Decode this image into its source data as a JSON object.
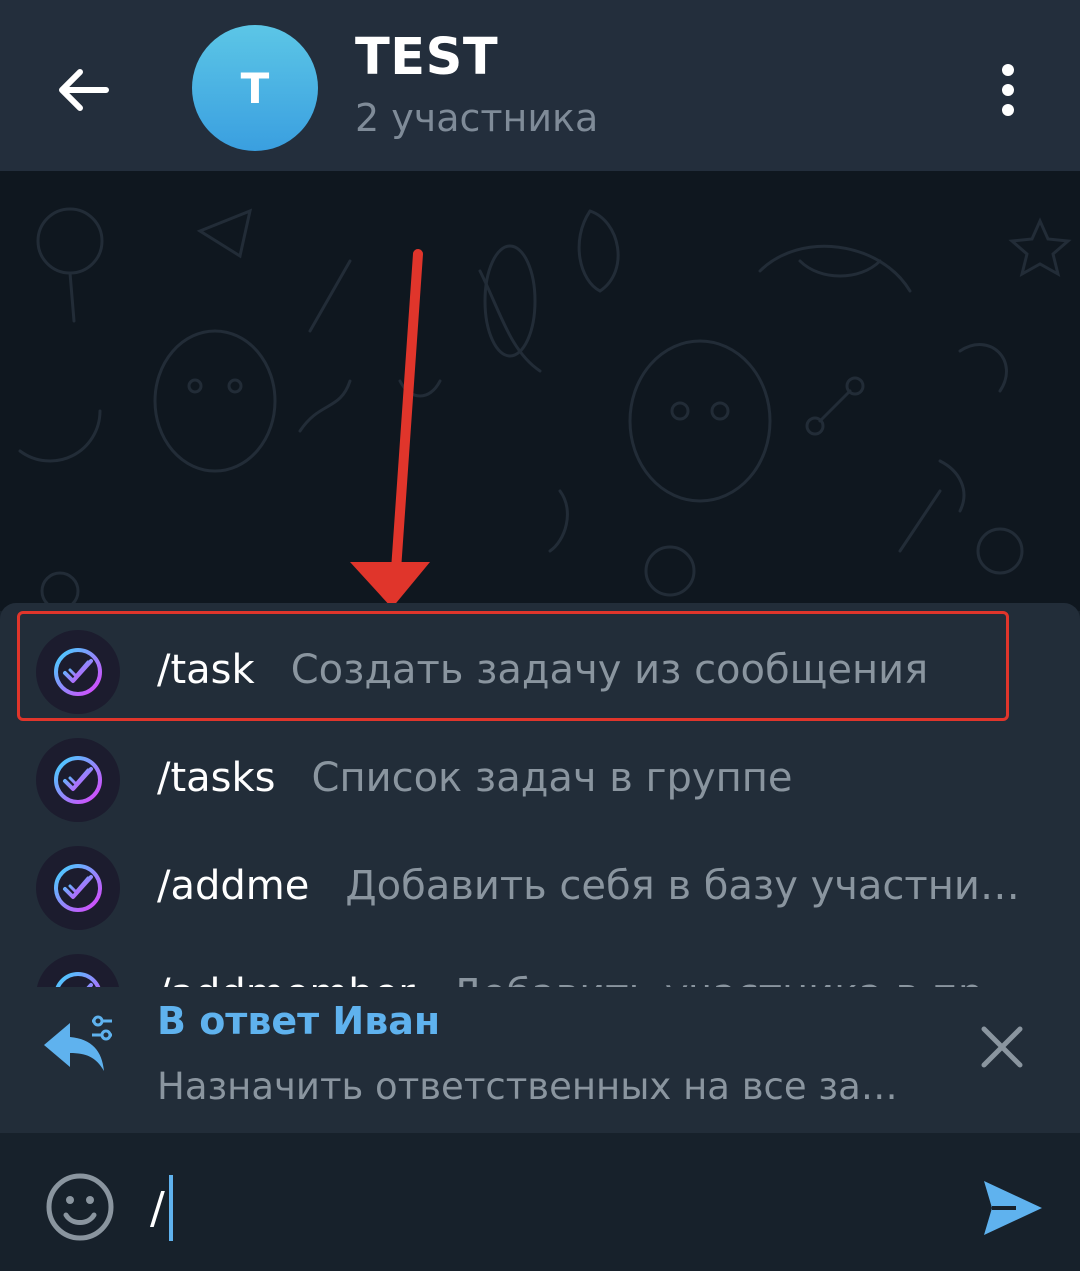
{
  "header": {
    "back_icon": "arrow-left-icon",
    "avatar_letter": "T",
    "title": "TEST",
    "subtitle": "2 участника",
    "more_icon": "more-vertical-icon"
  },
  "commands": [
    {
      "name": "/task",
      "description": "Создать задачу из сообщения",
      "icon": "check-badge-icon",
      "highlighted": true
    },
    {
      "name": "/tasks",
      "description": "Список задач в группе",
      "icon": "check-badge-icon"
    },
    {
      "name": "/addme",
      "description": "Добавить себя в базу участни…",
      "icon": "check-badge-icon"
    },
    {
      "name": "/addmember",
      "description": "Добавить участника в пр",
      "icon": "check-badge-icon"
    }
  ],
  "reply": {
    "icon": "reply-icon",
    "author": "В ответ Иван",
    "text": "Назначить ответственных на все за…",
    "close_icon": "close-icon"
  },
  "input": {
    "emoji_icon": "emoji-icon",
    "value": "/",
    "send_icon": "send-icon"
  },
  "colors": {
    "header_bg": "#232e3c",
    "panel_bg": "#222d39",
    "accent_blue": "#5fb2ee",
    "annotation_red": "#e0352b",
    "muted_text": "#8a959f"
  }
}
